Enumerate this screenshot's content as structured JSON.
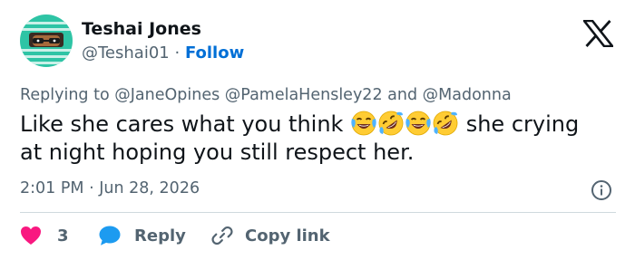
{
  "author": {
    "name": "Teshai Jones",
    "handle": "@Teshai01",
    "separator": "·",
    "follow_label": "Follow"
  },
  "reply_to": {
    "prefix": "Replying to",
    "mentions": [
      "@JaneOpines",
      "@PamelaHensley22"
    ],
    "conjunction": "and",
    "last_mention": "@Madonna"
  },
  "tweet": {
    "text_before": "Like she cares what you think",
    "emojis": [
      "face-with-tears-of-joy-icon",
      "rolling-on-floor-laughing-icon",
      "face-with-tears-of-joy-icon",
      "rolling-on-floor-laughing-icon"
    ],
    "text_after": "she crying at night hoping you still respect her."
  },
  "meta": {
    "time": "2:01 PM",
    "separator": "·",
    "date": "Jun 28, 2026"
  },
  "actions": {
    "like_count": "3",
    "reply_label": "Reply",
    "copy_link_label": "Copy link"
  },
  "colors": {
    "link_blue": "#006fd6",
    "like_pink": "#f91880",
    "reply_blue": "#1d9bf0",
    "muted_text": "#536471",
    "avatar_teal": "#2ec4a5"
  }
}
